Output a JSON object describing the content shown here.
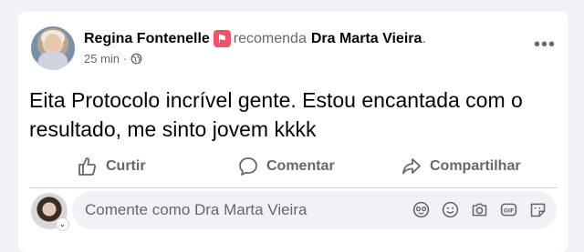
{
  "post": {
    "author": "Regina Fontenelle",
    "recommends": "recomenda",
    "page_name": "Dra Marta Vieira",
    "page_suffix": ".",
    "time": "25 min",
    "separator": "·",
    "audience_icon": "globe-icon",
    "text": "Eita Protocolo incrível gente. Estou encantada com o resultado, me sinto jovem kkkk"
  },
  "actions": {
    "like": "Curtir",
    "comment": "Comentar",
    "share": "Compartilhar"
  },
  "composer": {
    "placeholder": "Comente como Dra Marta Vieira",
    "icons": [
      "avatar-sticker-icon",
      "emoji-icon",
      "camera-icon",
      "gif-icon",
      "sticker-icon"
    ]
  },
  "colors": {
    "recommend_badge": "#f25268",
    "muted_text": "#65676b",
    "background": "#f0f2f5"
  }
}
